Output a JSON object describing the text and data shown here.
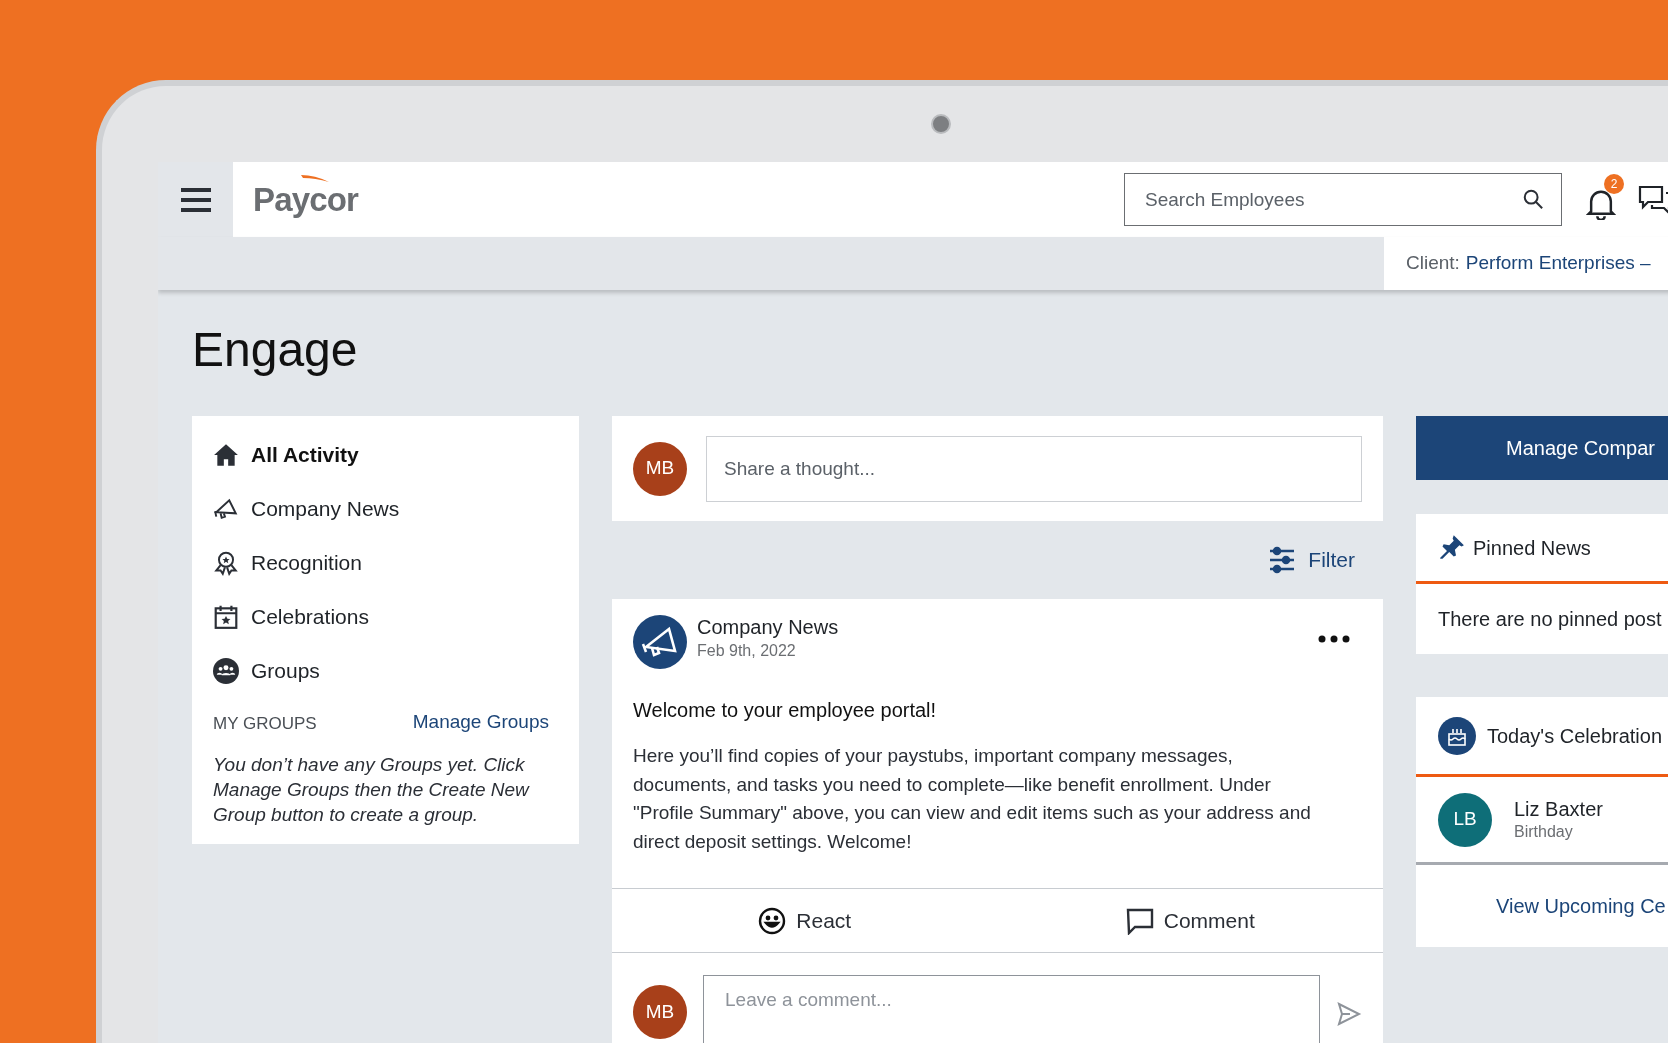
{
  "header": {
    "logo": "Paycor",
    "search": {
      "placeholder": "Search Employees"
    },
    "notification_count": "2"
  },
  "client_bar": {
    "label": "Client:",
    "value": "Perform Enterprises –"
  },
  "page_title": "Engage",
  "sidebar": {
    "items": [
      {
        "label": "All Activity",
        "kind": "home",
        "selected": true
      },
      {
        "label": "Company News",
        "kind": "news",
        "selected": false
      },
      {
        "label": "Recognition",
        "kind": "recognition",
        "selected": false
      },
      {
        "label": "Celebrations",
        "kind": "celebrations",
        "selected": false
      },
      {
        "label": "Groups",
        "kind": "groups",
        "selected": false
      }
    ],
    "my_groups": {
      "heading": "MY GROUPS",
      "link": "Manage Groups",
      "empty_text": "You don’t have any Groups yet. Click Manage Groups then the Create New Group button to create a group."
    }
  },
  "composer": {
    "avatar": "MB",
    "placeholder": "Share a thought..."
  },
  "filter": "Filter",
  "post": {
    "source": "Company News",
    "date": "Feb 9th, 2022",
    "title": "Welcome to your employee portal!",
    "body": "Here you’ll find copies of your paystubs, important company messages, documents, and tasks you need to complete—like benefit enrollment. Under \"Profile Summary\" above, you can view and edit items such as your address and direct deposit settings. Welcome!",
    "actions": [
      "React",
      "Comment"
    ],
    "comment": {
      "avatar": "MB",
      "placeholder": "Leave a comment..."
    }
  },
  "right_panel": {
    "manage_button": "Manage Compar",
    "pinned": {
      "title": "Pinned News",
      "empty_text": "There are no pinned post"
    },
    "celebrations": {
      "title": "Today's Celebration",
      "people": [
        {
          "initials": "LB",
          "name": "Liz Baxter",
          "occasion": "Birthday",
          "color": "#0e6e78"
        }
      ],
      "link": "View Upcoming Ce"
    }
  }
}
